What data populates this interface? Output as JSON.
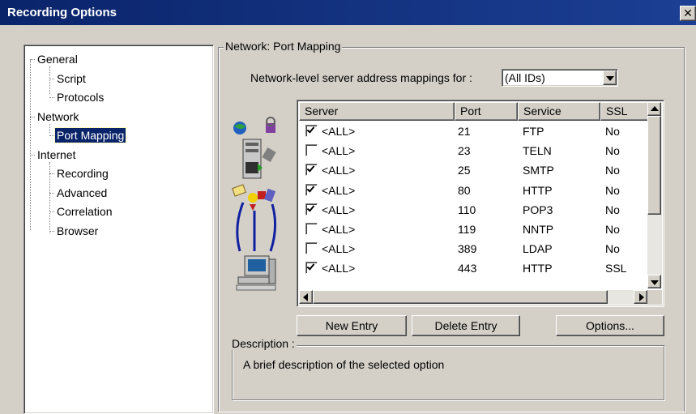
{
  "window": {
    "title": "Recording Options",
    "close_glyph": "✕"
  },
  "tree": {
    "items": [
      {
        "label": "General",
        "level": 0
      },
      {
        "label": "Script",
        "level": 1
      },
      {
        "label": "Protocols",
        "level": 1
      },
      {
        "label": "Network",
        "level": 0
      },
      {
        "label": "Port Mapping",
        "level": 1,
        "selected": true
      },
      {
        "label": "Internet",
        "level": 0
      },
      {
        "label": "Recording",
        "level": 1
      },
      {
        "label": "Advanced",
        "level": 1
      },
      {
        "label": "Correlation",
        "level": 1
      },
      {
        "label": "Browser",
        "level": 1
      }
    ]
  },
  "panel": {
    "group_title": "Network: Port Mapping",
    "mapping_label": "Network-level server address mappings for :",
    "mapping_value": "(All IDs)"
  },
  "table": {
    "columns": [
      "Server",
      "Port",
      "Service",
      "SSL"
    ],
    "rows": [
      {
        "checked": true,
        "server": "<ALL>",
        "port": "21",
        "service": "FTP",
        "ssl": "No"
      },
      {
        "checked": false,
        "server": "<ALL>",
        "port": "23",
        "service": "TELN",
        "ssl": "No"
      },
      {
        "checked": true,
        "server": "<ALL>",
        "port": "25",
        "service": "SMTP",
        "ssl": "No"
      },
      {
        "checked": true,
        "server": "<ALL>",
        "port": "80",
        "service": "HTTP",
        "ssl": "No"
      },
      {
        "checked": true,
        "server": "<ALL>",
        "port": "110",
        "service": "POP3",
        "ssl": "No"
      },
      {
        "checked": false,
        "server": "<ALL>",
        "port": "119",
        "service": "NNTP",
        "ssl": "No"
      },
      {
        "checked": false,
        "server": "<ALL>",
        "port": "389",
        "service": "LDAP",
        "ssl": "No"
      },
      {
        "checked": true,
        "server": "<ALL>",
        "port": "443",
        "service": "HTTP",
        "ssl": "SSL"
      }
    ]
  },
  "buttons": {
    "new_entry": "New Entry",
    "delete_entry": "Delete Entry",
    "options": "Options..."
  },
  "description": {
    "label": "Description :",
    "text": "A brief description of the selected option"
  },
  "icons": {
    "illustration": "network-servers-illustration",
    "close": "close-icon",
    "dropdown": "dropdown-arrow-icon"
  }
}
